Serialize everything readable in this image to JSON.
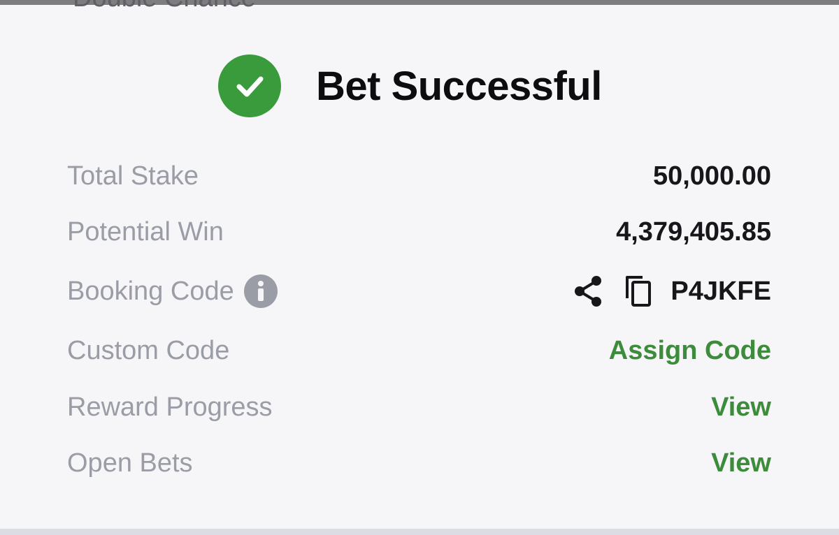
{
  "previous_item": {
    "text": "Double Chance"
  },
  "header": {
    "icon": "check-circle-icon",
    "title": "Bet Successful"
  },
  "rows": {
    "total_stake": {
      "label": "Total Stake",
      "value": "50,000.00"
    },
    "potential_win": {
      "label": "Potential Win",
      "value": "4,379,405.85"
    },
    "booking_code": {
      "label": "Booking Code",
      "info_icon": "info-icon",
      "share_icon": "share-icon",
      "copy_icon": "copy-icon",
      "value": "P4JKFE"
    },
    "custom_code": {
      "label": "Custom Code",
      "action": "Assign Code"
    },
    "reward_progress": {
      "label": "Reward Progress",
      "action": "View"
    },
    "open_bets": {
      "label": "Open Bets",
      "action": "View"
    }
  },
  "colors": {
    "success_green": "#3a9b3c",
    "link_green": "#3c8c3c",
    "label_gray": "#9a9ca6",
    "value_dark": "#17171b",
    "background": "#f6f6f8"
  }
}
